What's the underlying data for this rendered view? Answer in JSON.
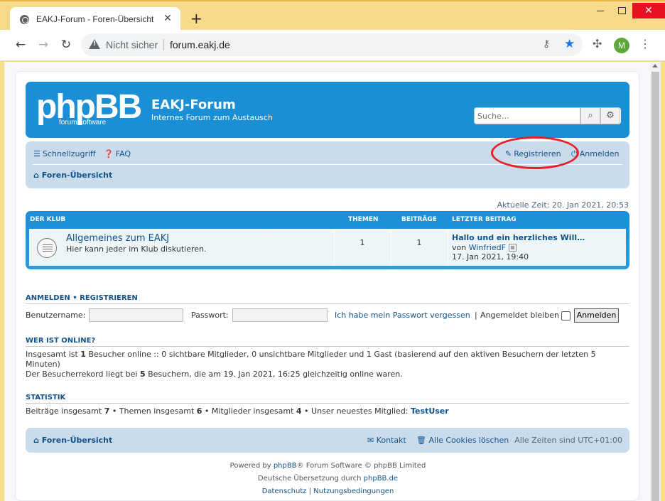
{
  "browser": {
    "tab_title": "EAKJ-Forum - Foren-Übersicht",
    "tab_close": "✕",
    "new_tab": "+",
    "win_close": "✕",
    "security_label": "Nicht sicher",
    "url": "forum.eakj.de",
    "profile_initial": "M",
    "icons": [
      "globe-icon",
      "back-icon",
      "forward-icon",
      "reload-icon",
      "warning-icon",
      "key-icon",
      "star-icon",
      "puzzle-icon",
      "kebab-menu-icon"
    ],
    "accent": "#1a73e8",
    "titlebar_color": "#f6d98a"
  },
  "header": {
    "logo_text": "phpBB",
    "logo_sub": "forum software",
    "site_title": "EAKJ-Forum",
    "site_desc": "Internes Forum zum Austausch",
    "search_placeholder": "Suche…",
    "color": "#1a8fd6"
  },
  "navbar": {
    "quick_access": "Schnellzugriff",
    "faq": "FAQ",
    "register": "Registrieren",
    "login": "Anmelden",
    "breadcrumb": "Foren-Übersicht"
  },
  "current_time": "Aktuelle Zeit: 20. Jan 2021, 20:53",
  "forum_table": {
    "category": "Der Klub",
    "col_topics": "Themen",
    "col_posts": "Beiträge",
    "col_last": "Letzter Beitrag",
    "rows": [
      {
        "name": "Allgemeines zum EAKJ",
        "desc": "Hier kann jeder im Klub diskutieren.",
        "topics": "1",
        "posts": "1",
        "last_title": "Hallo und ein herzliches Will…",
        "last_by": "von",
        "last_user": "WinfriedF",
        "last_date": "17. Jan 2021, 19:40"
      }
    ]
  },
  "login_section": {
    "heading_login": "Anmelden",
    "heading_sep": "•",
    "heading_register": "Registrieren",
    "username_label": "Benutzername:",
    "password_label": "Passwort:",
    "forgot": "Ich habe mein Passwort vergessen",
    "pipe": "|",
    "remember": "Angemeldet bleiben",
    "submit": "Anmelden"
  },
  "online": {
    "heading": "Wer ist online?",
    "line1_pre": "Insgesamt ist ",
    "line1_count": "1",
    "line1_post": " Besucher online :: 0 sichtbare Mitglieder, 0 unsichtbare Mitglieder und 1 Gast (basierend auf den aktiven Besuchern der letzten 5 Minuten)",
    "line2_pre": "Der Besucherrekord liegt bei ",
    "line2_count": "5",
    "line2_post": " Besuchern, die am 19. Jan 2021, 16:25 gleichzeitig online waren."
  },
  "stats": {
    "heading": "Statistik",
    "posts_label": "Beiträge insgesamt ",
    "posts": "7",
    "topics_label": " • Themen insgesamt ",
    "topics": "6",
    "members_label": " • Mitglieder insgesamt ",
    "members": "4",
    "newest_label": " • Unser neuestes Mitglied: ",
    "newest": "TestUser"
  },
  "footer_nav": {
    "breadcrumb": "Foren-Übersicht",
    "contact": "Kontakt",
    "delete_cookies": "Alle Cookies löschen",
    "timezone": "Alle Zeiten sind UTC+01:00"
  },
  "copyright": {
    "powered_pre": "Powered by ",
    "powered_link": "phpBB",
    "powered_post": "® Forum Software © phpBB Limited",
    "translation_pre": "Deutsche Übersetzung durch ",
    "translation_link": "phpBB.de",
    "privacy": "Datenschutz",
    "sep": "|",
    "terms": "Nutzungsbedingungen"
  }
}
